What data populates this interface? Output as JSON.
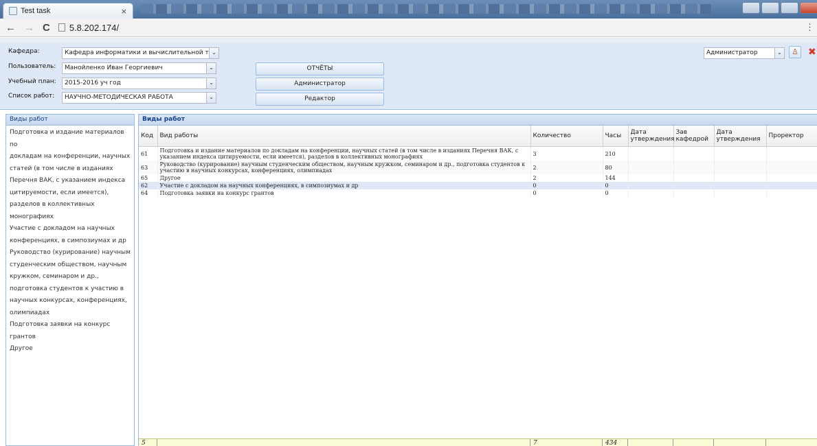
{
  "browser": {
    "tab_title": "Test task",
    "tab_close": "×",
    "back": "←",
    "forward": "→",
    "reload": "C",
    "url": "5.8.202.174/",
    "menu": "⋮"
  },
  "form": {
    "department_label": "Кафедра:",
    "department_value": "Кафедра информатики и вычислительной техни",
    "user_label": "Пользователь:",
    "user_value": "Манойленко Иван Георгиевич",
    "plan_label": "Учебный план:",
    "plan_value": "2015-2016 уч год",
    "works_label": "Список работ:",
    "works_value": "НАУЧНО-МЕТОДИЧЕСКАЯ РАБОТА",
    "role_value": "Администратор",
    "select_arrow": "⌄"
  },
  "buttons": {
    "reports": "ОТЧЁТЫ",
    "admin": "Администратор",
    "editor": "Редактор"
  },
  "left_panel": {
    "title": "Виды работ",
    "items": [
      "Подготовка и издание материалов по",
      "докладам на конференции, научных",
      "статей (в том числе в изданиях",
      "Перечня ВАК, с указанием индекса",
      "цитируемости, если имеется),",
      "разделов в коллективных",
      "монографиях",
      "Участие с докладом на научных",
      "конференциях, в симпозиумах и др",
      "Руководство (курирование) научным",
      "студенческим обществом, научным",
      "кружком, семинаром и др.,",
      "подготовка студентов к участию в",
      "научных конкурсах, конференциях,",
      "олимпиадах",
      "Подготовка заявки на конкурс грантов",
      "Другое"
    ]
  },
  "grid": {
    "title": "Виды работ",
    "columns": [
      "Код",
      "Вид работы",
      "Количество",
      "Часы",
      "Дата утверждения",
      "Зав кафедрой",
      "Дата утверждения",
      "Проректор"
    ],
    "rows": [
      {
        "code": "61",
        "name": "Подготовка и издание материалов по докладам на конференции, научных статей (в том числе в изданиях Перечня ВАК, с указанием индекса цитируемости, если имеется), разделов в коллективных монографиях",
        "qty": "3",
        "hours": "210"
      },
      {
        "code": "63",
        "name": "Руководство (курирование) научным студенческим обществом, научным кружком, семинаром и др., подготовка студентов к участию в научных конкурсах, конференциях, олимпиадах",
        "qty": "2",
        "hours": "80"
      },
      {
        "code": "65",
        "name": "Другое",
        "qty": "2",
        "hours": "144"
      },
      {
        "code": "62",
        "name": "Участие с докладом на научных конференциях, в симпозиумах и др",
        "qty": "0",
        "hours": "0"
      },
      {
        "code": "64",
        "name": "Подготовка заявки на конкурс грантов",
        "qty": "0",
        "hours": "0"
      }
    ],
    "summary": {
      "count": "5",
      "qty": "7",
      "hours": "434"
    }
  }
}
